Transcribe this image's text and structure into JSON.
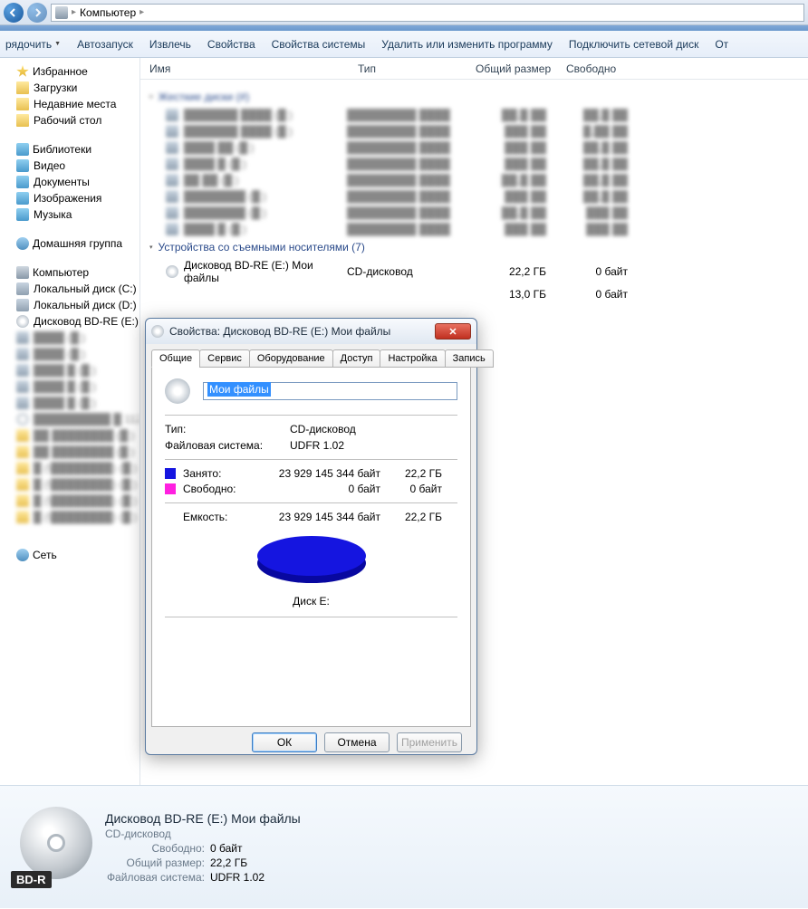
{
  "breadcrumb": {
    "item": "Компьютер"
  },
  "toolbar": {
    "organize": "рядочить",
    "autoplay": "Автозапуск",
    "extract": "Извлечь",
    "properties": "Свойства",
    "sysprops": "Свойства системы",
    "uninstall": "Удалить или изменить программу",
    "mapdrive": "Подключить сетевой диск",
    "last": "От"
  },
  "columns": {
    "name": "Имя",
    "type": "Тип",
    "total": "Общий размер",
    "free": "Свободно"
  },
  "sidebar": {
    "favorites": "Избранное",
    "fav_items": [
      "Загрузки",
      "Недавние места",
      "Рабочий стол"
    ],
    "libraries": "Библиотеки",
    "lib_items": [
      "Видео",
      "Документы",
      "Изображения",
      "Музыка"
    ],
    "homegroup": "Домашняя группа",
    "computer": "Компьютер",
    "comp_items": [
      "Локальный диск (C:)",
      "Локальный диск (D:)",
      "Дисковод BD-RE (E:) Мои"
    ],
    "network": "Сеть"
  },
  "groups": {
    "hdd_blurred": "Жесткие диски (#)",
    "removable": "Устройства со съемными носителями (7)"
  },
  "rows": {
    "bdre": {
      "name": "Дисковод BD-RE (E:) Мои файлы",
      "type": "CD-дисковод",
      "size": "22,2 ГБ",
      "free": "0 байт"
    },
    "other": {
      "size": "13,0 ГБ",
      "free": "0 байт"
    }
  },
  "details": {
    "title": "Дисковод BD-RE (E:) Мои файлы",
    "subtitle": "CD-дисковод",
    "free_label": "Свободно:",
    "free_val": "0 байт",
    "total_label": "Общий размер:",
    "total_val": "22,2 ГБ",
    "fs_label": "Файловая система:",
    "fs_val": "UDFR 1.02",
    "badge": "BD-R"
  },
  "dialog": {
    "title": "Свойства: Дисковод BD-RE (E:) Мои файлы",
    "tabs": [
      "Общие",
      "Сервис",
      "Оборудование",
      "Доступ",
      "Настройка",
      "Запись"
    ],
    "name_value": "Мои файлы",
    "type_label": "Тип:",
    "type_value": "CD-дисковод",
    "fs_label": "Файловая система:",
    "fs_value": "UDFR 1.02",
    "used_label": "Занято:",
    "used_bytes": "23 929 145 344 байт",
    "used_gb": "22,2 ГБ",
    "free_label": "Свободно:",
    "free_bytes": "0 байт",
    "free_gb": "0 байт",
    "capacity_label": "Емкость:",
    "capacity_bytes": "23 929 145 344 байт",
    "capacity_gb": "22,2 ГБ",
    "disk_label": "Диск E:",
    "ok": "ОК",
    "cancel": "Отмена",
    "apply": "Применить"
  },
  "chart_data": {
    "type": "pie",
    "title": "Диск E:",
    "series": [
      {
        "name": "Занято",
        "value": 23929145344,
        "display": "22,2 ГБ",
        "color": "#1515e0"
      },
      {
        "name": "Свободно",
        "value": 0,
        "display": "0 байт",
        "color": "#ff20e0"
      }
    ]
  }
}
